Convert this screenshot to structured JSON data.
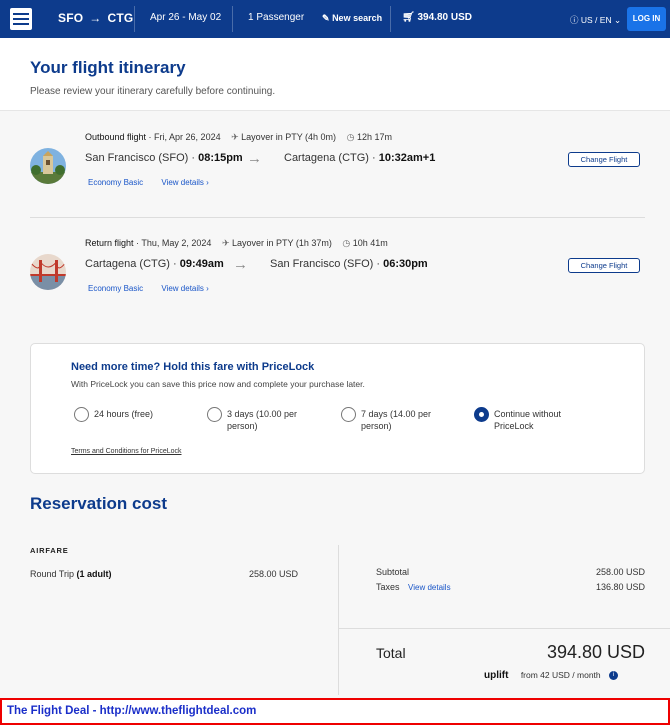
{
  "topbar": {
    "origin": "SFO",
    "arrow": "→",
    "destination": "CTG",
    "dates": "Apr 26 - May 02",
    "passengers": "1 Passenger",
    "new_search": "New search",
    "cart_total": "394.80 USD",
    "locale": "US / EN",
    "login": "LOG IN"
  },
  "header": {
    "title": "Your flight itinerary",
    "subtitle": "Please review your itinerary carefully before continuing."
  },
  "flights": [
    {
      "label": "Outbound flight",
      "date": " · Fri, Apr 26, 2024",
      "layover": "Layover in PTY (4h 0m)",
      "duration": "12h 17m",
      "from": "San Francisco (SFO) · ",
      "dep_time": "08:15pm",
      "to": "Cartagena (CTG) · ",
      "arr_time": "10:32am+1",
      "fare": "Economy Basic",
      "details": "View details  ›",
      "change": "Change Flight"
    },
    {
      "label": "Return flight",
      "date": " · Thu, May 2, 2024",
      "layover": "Layover in PTY (1h 37m)",
      "duration": "10h 41m",
      "from": "Cartagena (CTG) · ",
      "dep_time": "09:49am",
      "to": "San Francisco (SFO) · ",
      "arr_time": "06:30pm",
      "fare": "Economy Basic",
      "details": "View details  ›",
      "change": "Change Flight"
    }
  ],
  "pricelock": {
    "title": "Need more time? Hold this fare with PriceLock",
    "subtitle": "With PriceLock you can save this price now and complete your purchase later.",
    "options": [
      {
        "label": "24 hours (free)",
        "selected": false
      },
      {
        "label": "3 days (10.00 per person)",
        "selected": false
      },
      {
        "label": "7 days (14.00 per person)",
        "selected": false
      },
      {
        "label": "Continue without PriceLock",
        "selected": true
      }
    ],
    "terms": "Terms and Conditions for PriceLock"
  },
  "reservation": {
    "title": "Reservation cost",
    "airfare_label": "AIRFARE",
    "trip_label": "Round Trip",
    "trip_pax": "(1 adult)",
    "trip_price": "258.00 USD",
    "subtotal_label": "Subtotal",
    "subtotal": "258.00 USD",
    "taxes_label": "Taxes",
    "taxes_link": "View details",
    "taxes": "136.80 USD",
    "total_label": "Total",
    "total": "394.80 USD",
    "uplift_brand": "uplift",
    "uplift_text": "from 42 USD  / month"
  },
  "footer": {
    "text": "The Flight Deal - http://www.theflightdeal.com"
  },
  "colors": {
    "brand_navy": "#0d3b8c",
    "link_blue": "#1a56c8",
    "login_blue": "#1a73e8",
    "footer_border": "#e00000"
  }
}
